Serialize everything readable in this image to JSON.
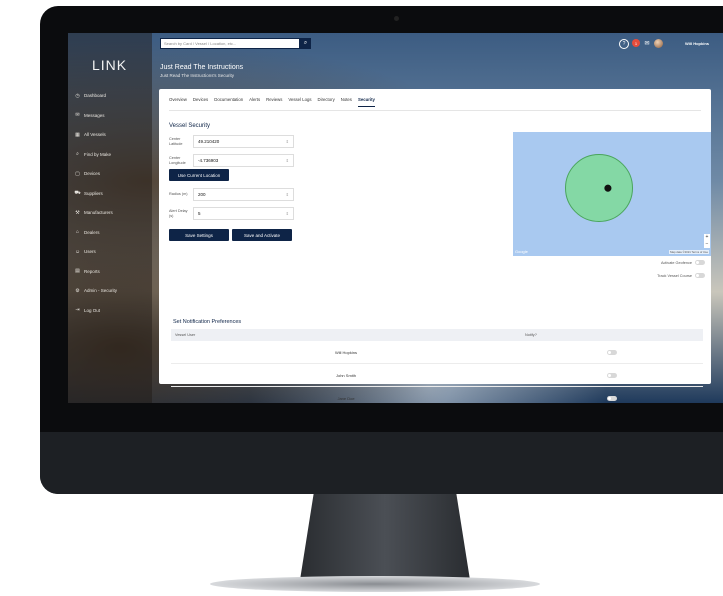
{
  "app": {
    "logo": "LINK"
  },
  "sidebar": {
    "items": [
      {
        "icon": "dashboard-icon",
        "glyph": "◷",
        "label": "Dashboard"
      },
      {
        "icon": "messages-icon",
        "glyph": "✉",
        "label": "Messages"
      },
      {
        "icon": "vessels-icon",
        "glyph": "▦",
        "label": "All Vessels"
      },
      {
        "icon": "find-icon",
        "glyph": "⌕",
        "label": "Find by Make"
      },
      {
        "icon": "devices-icon",
        "glyph": "▢",
        "label": "Devices"
      },
      {
        "icon": "suppliers-icon",
        "glyph": "⛟",
        "label": "Suppliers"
      },
      {
        "icon": "manufacturers-icon",
        "glyph": "⚒",
        "label": "Manufacturers"
      },
      {
        "icon": "dealers-icon",
        "glyph": "⌂",
        "label": "Dealers"
      },
      {
        "icon": "users-icon",
        "glyph": "☺",
        "label": "Users"
      },
      {
        "icon": "reports-icon",
        "glyph": "▤",
        "label": "Reports"
      },
      {
        "icon": "admin-icon",
        "glyph": "⚙",
        "label": "Admin - Security"
      },
      {
        "icon": "logout-icon",
        "glyph": "⇥",
        "label": "Log Out"
      }
    ]
  },
  "topbar": {
    "search_placeholder": "Search by Card / Vessel / Location, etc...",
    "username": "Will Hopkins",
    "notification_count": "1"
  },
  "page": {
    "title": "Just Read The Instructions",
    "subtitle": "Just Read The Instructions's Security"
  },
  "tabs": [
    "Overview",
    "Devices",
    "Documentation",
    "Alerts",
    "Reviews",
    "Vessel Logs",
    "Directory",
    "Notes",
    "Security"
  ],
  "active_tab": "Security",
  "security": {
    "section_title": "Vessel Security",
    "center_lat_label": "Center Latitude",
    "center_lat_value": "49.210420",
    "center_lng_label": "Center Longitude",
    "center_lng_value": "-4.736903",
    "use_location_label": "Use Current Location",
    "radius_label": "Radius (m)",
    "radius_value": "200",
    "alert_delay_label": "Alert Delay (s)",
    "alert_delay_value": "5",
    "save_label": "Save Settings",
    "save_activate_label": "Save and Activate",
    "activate_geofence_label": "Activate Geofence",
    "track_course_label": "Track Vessel Course"
  },
  "map": {
    "google_label": "Google",
    "attribution": "Map data ©2021  Terms of Use",
    "zoom_in": "+",
    "zoom_out": "−"
  },
  "notifications": {
    "title": "Set Notification Preferences",
    "col_user": "Vessel User",
    "col_notify": "Notify?",
    "rows": [
      {
        "name": "Will Hopkins"
      },
      {
        "name": "John Smith"
      },
      {
        "name": "Jane Doe"
      }
    ]
  },
  "colors": {
    "accent": "#0e2447",
    "geofence": "#78dc8c",
    "map_water": "#a9c9f0"
  }
}
